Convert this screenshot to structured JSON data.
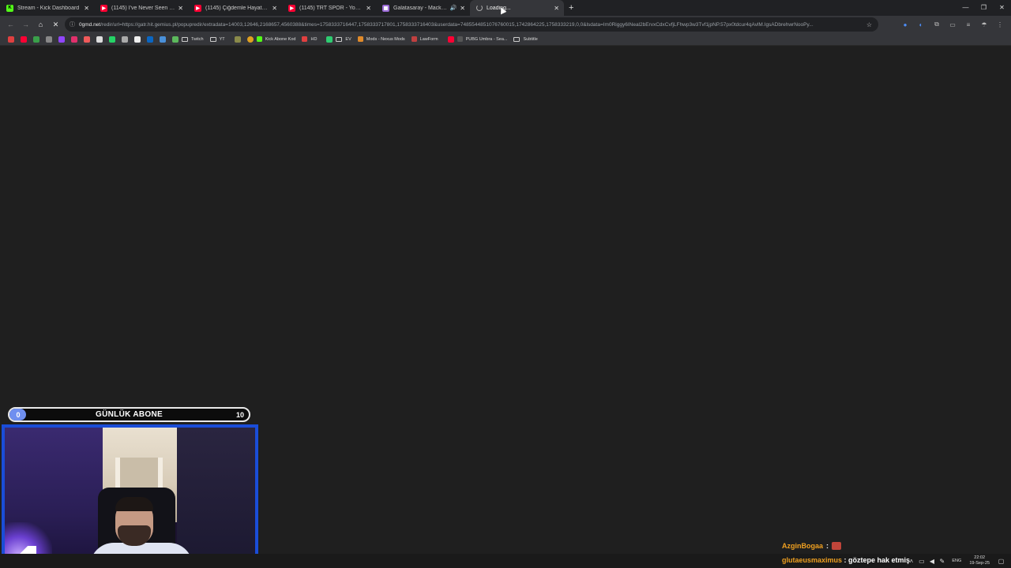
{
  "tabs": [
    {
      "title": "Stream - Kick Dashboard",
      "favicon_color": "#53fc18",
      "favicon_glyph": "K",
      "active": false
    },
    {
      "title": "(1145) I've Never Seen So Many...",
      "favicon_color": "#ff0033",
      "favicon_glyph": "▶",
      "active": false
    },
    {
      "title": "(1145) Çiğdemle Hayat - YouTube",
      "favicon_color": "#ff0033",
      "favicon_glyph": "▶",
      "active": false
    },
    {
      "title": "(1145) TRT SPOR - YouTube",
      "favicon_color": "#ff0033",
      "favicon_glyph": "▶",
      "active": false
    },
    {
      "title": "Galatasaray - Mackolik.com.tr",
      "favicon_color": "#9b6bd6",
      "favicon_glyph": "▦",
      "active": false,
      "audio": true
    },
    {
      "title": "Loading...",
      "loading": true,
      "active": true
    }
  ],
  "address_bar": {
    "domain": "0gmd.net",
    "path": "/redir/url=https://gatr.hit.gemius.pl/popupredir/extradata=14003,12646,2168657,4560388&times=1758333716447,1758333717801,1758333716403&userdata=7485544851076760015,1742864225,1758333219,0,0&lsdata=Im0Riggy6INeal2bErvxCdxCvfjLFhwp3w3Tvf1jpNP.57px0tdcur4qAvlM.IgsADbrehwrNooPy..."
  },
  "bookmarks": [
    {
      "label": "Twitch",
      "type": "folder"
    },
    {
      "label": "YT",
      "type": "folder"
    },
    {
      "label": "Kick Abone Kod",
      "type": "link",
      "color": "#53fc18"
    },
    {
      "label": "HD",
      "type": "link",
      "color": "#e04040"
    },
    {
      "label": "EV",
      "type": "folder"
    },
    {
      "label": "Mods - Nexus Mods",
      "type": "link",
      "color": "#e08a2a"
    },
    {
      "label": "LawForm",
      "type": "link",
      "color": "#c04040"
    },
    {
      "label": "PUBG Umbra - Sea...",
      "type": "link",
      "color": "#333333"
    },
    {
      "label": "Subtitle",
      "type": "folder"
    }
  ],
  "overlay": {
    "title": "GÜNLÜK ABONE",
    "current": "0",
    "goal": "10",
    "progress_percent": 6,
    "bar_color": "#6f8ff0"
  },
  "chat": [
    {
      "user": "AzginBogaa",
      "message": ""
    },
    {
      "user": "glutaeusmaximus",
      "message": "göztepe hak etmiş"
    }
  ],
  "tray": {
    "language": "ENG",
    "time": "22:02",
    "date": "19-Sep-25"
  }
}
